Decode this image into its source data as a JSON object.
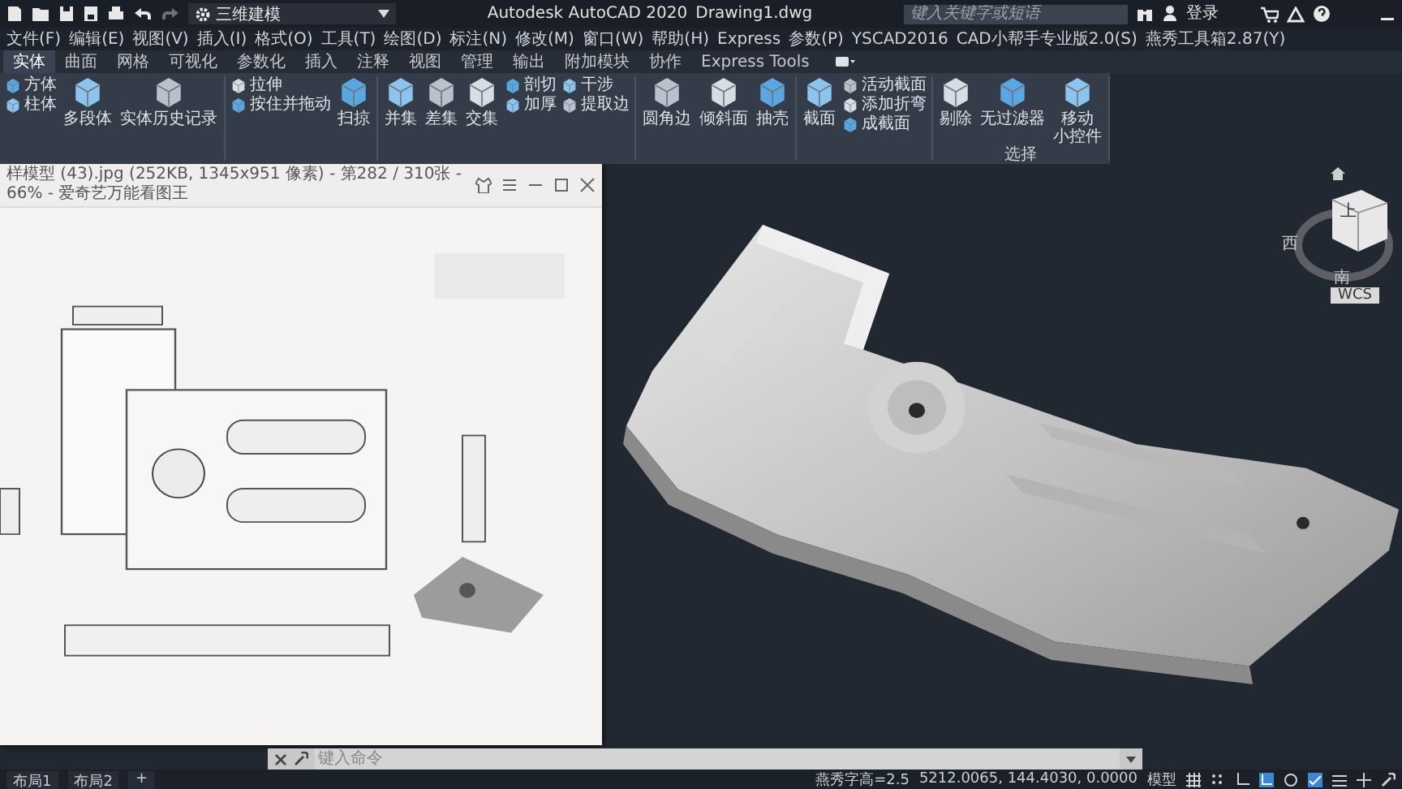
{
  "quick_access": {
    "workspace": "三维建模"
  },
  "title": {
    "app": "Autodesk AutoCAD 2020",
    "document": "Drawing1.dwg"
  },
  "search": {
    "placeholder": "键入关键字或短语"
  },
  "sign_in": "登录",
  "menu": [
    "文件(F)",
    "编辑(E)",
    "视图(V)",
    "插入(I)",
    "格式(O)",
    "工具(T)",
    "绘图(D)",
    "标注(N)",
    "修改(M)",
    "窗口(W)",
    "帮助(H)",
    "Express",
    "参数(P)",
    "YSCAD2016",
    "CAD小帮手专业版2.0(S)",
    "燕秀工具箱2.87(Y)"
  ],
  "ribbon_tabs": [
    {
      "label": "实体",
      "selected": true
    },
    {
      "label": "曲面",
      "selected": false
    },
    {
      "label": "网格",
      "selected": false
    },
    {
      "label": "可视化",
      "selected": false
    },
    {
      "label": "参数化",
      "selected": false
    },
    {
      "label": "插入",
      "selected": false
    },
    {
      "label": "注释",
      "selected": false
    },
    {
      "label": "视图",
      "selected": false
    },
    {
      "label": "管理",
      "selected": false
    },
    {
      "label": "输出",
      "selected": false
    },
    {
      "label": "附加模块",
      "selected": false
    },
    {
      "label": "协作",
      "selected": false
    },
    {
      "label": "Express Tools",
      "selected": false
    }
  ],
  "ribbon_panels": [
    {
      "items": [
        {
          "kind": "small",
          "labels": [
            "方体",
            "柱体"
          ]
        },
        {
          "kind": "large",
          "label": "多段体"
        },
        {
          "kind": "large",
          "label": "实体历史记录"
        }
      ]
    },
    {
      "items": [
        {
          "kind": "small",
          "labels": [
            "拉伸",
            "按住并拖动"
          ]
        },
        {
          "kind": "large",
          "label": "扫掠"
        }
      ]
    },
    {
      "items": [
        {
          "kind": "large",
          "label": "并集"
        },
        {
          "kind": "large",
          "label": "差集"
        },
        {
          "kind": "large",
          "label": "交集"
        },
        {
          "kind": "small",
          "labels": [
            "剖切",
            "加厚"
          ]
        },
        {
          "kind": "small",
          "labels": [
            "干涉",
            "提取边"
          ]
        }
      ]
    },
    {
      "items": [
        {
          "kind": "large",
          "label": "圆角边"
        },
        {
          "kind": "large",
          "label": "倾斜面"
        },
        {
          "kind": "large",
          "label": "抽壳"
        }
      ]
    },
    {
      "items": [
        {
          "kind": "large",
          "label": "截面"
        },
        {
          "kind": "small",
          "labels": [
            "活动截面",
            "添加折弯",
            "成截面"
          ]
        }
      ]
    },
    {
      "label": "选择",
      "items": [
        {
          "kind": "large",
          "label": "剔除"
        },
        {
          "kind": "large",
          "label": "无过滤器"
        },
        {
          "kind": "large",
          "lines": [
            "移动",
            "小控件"
          ]
        }
      ]
    }
  ],
  "image_viewer": {
    "title": "样模型 (43).jpg (252KB, 1345x951 像素) - 第282 / 310张 - 66% - 爱奇艺万能看图王"
  },
  "viewcube": {
    "face": "上",
    "west": "西",
    "south": "南",
    "ucs": "WCS"
  },
  "command_line": {
    "placeholder": "键入命令"
  },
  "layout_tabs": [
    {
      "label": "布局1",
      "selected": false
    },
    {
      "label": "布局2",
      "selected": false
    }
  ],
  "add_layout": "+",
  "status": {
    "text_height": "燕秀字高=2.5",
    "coordinates": "5212.0065, 144.4030, 0.0000",
    "space": "模型"
  }
}
